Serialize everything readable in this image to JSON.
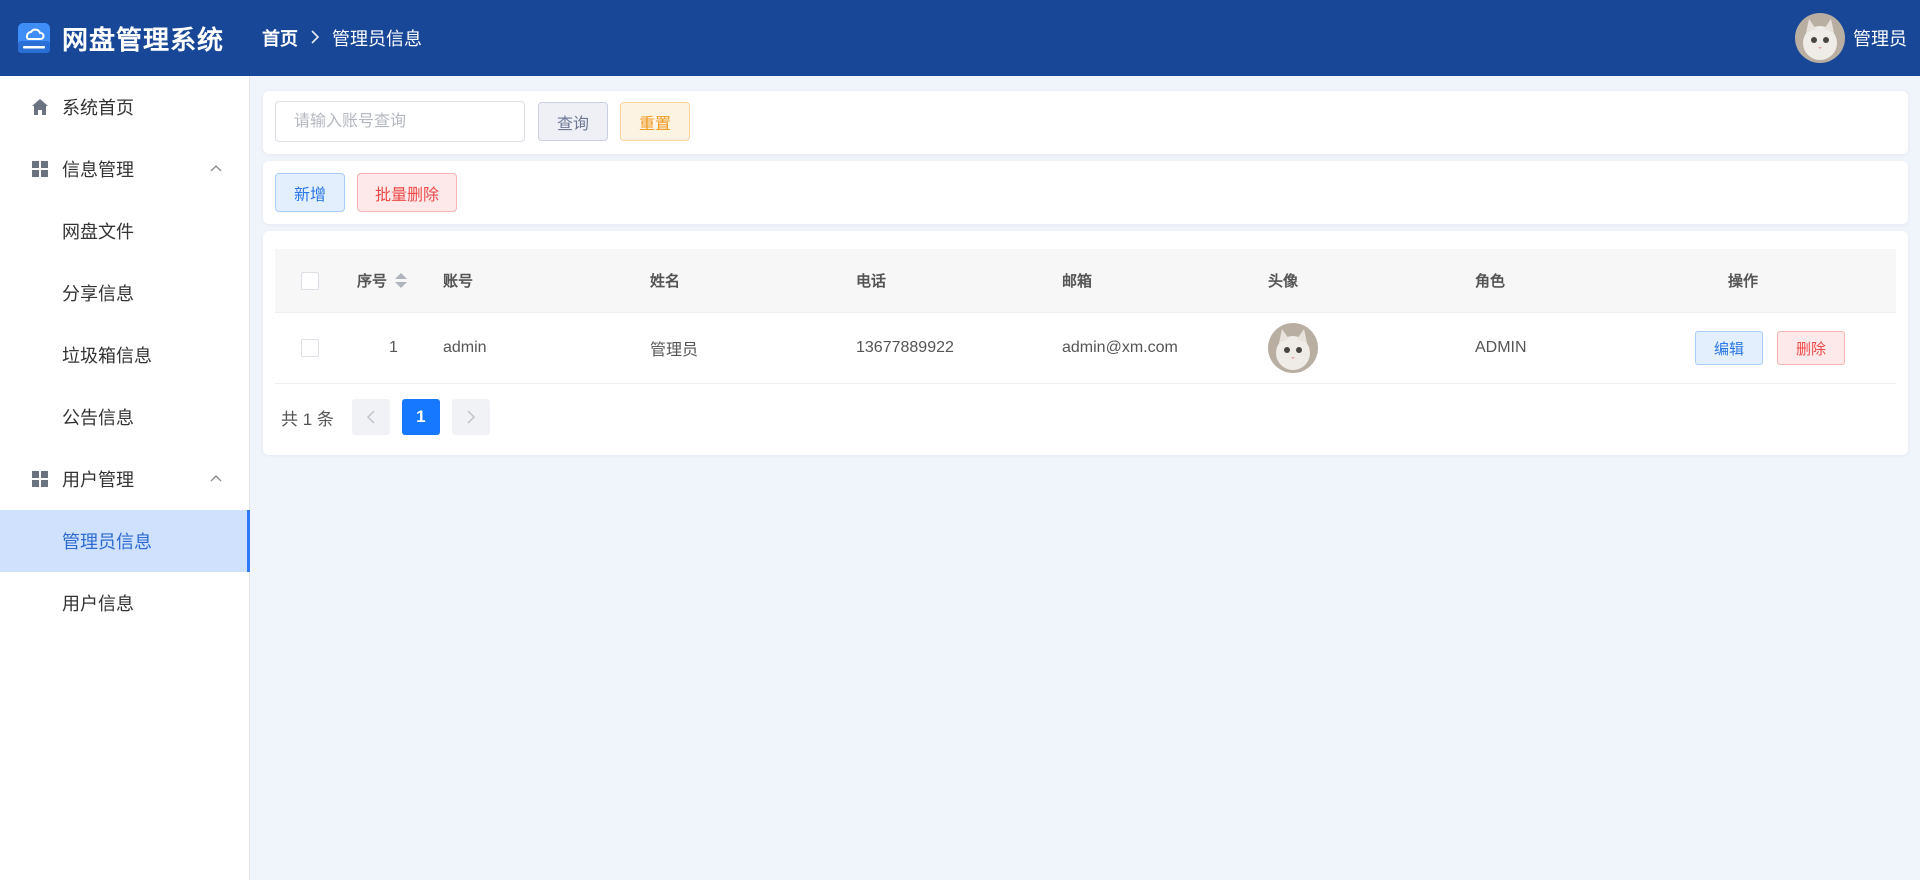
{
  "app": {
    "title": "网盘管理系统"
  },
  "header": {
    "breadcrumb_home": "首页",
    "breadcrumb_current": "管理员信息",
    "user_name": "管理员"
  },
  "sidebar": {
    "home_label": "系统首页",
    "groups": [
      {
        "label": "信息管理",
        "items": [
          "网盘文件",
          "分享信息",
          "垃圾箱信息",
          "公告信息"
        ]
      },
      {
        "label": "用户管理",
        "items": [
          "管理员信息",
          "用户信息"
        ]
      }
    ],
    "active_item": "管理员信息"
  },
  "search": {
    "placeholder": "请输入账号查询",
    "query_label": "查询",
    "reset_label": "重置"
  },
  "operations": {
    "add_label": "新增",
    "batch_delete_label": "批量删除"
  },
  "table": {
    "columns": [
      "序号",
      "账号",
      "姓名",
      "电话",
      "邮箱",
      "头像",
      "角色",
      "操作"
    ],
    "rows": [
      {
        "index": "1",
        "username": "admin",
        "name": "管理员",
        "phone": "13677889922",
        "email": "admin@xm.com",
        "role": "ADMIN",
        "edit_label": "编辑",
        "delete_label": "删除"
      }
    ]
  },
  "pagination": {
    "total_text": "共 1 条",
    "current_page": "1"
  },
  "colors": {
    "header_bg": "#184797",
    "primary": "#1677ff",
    "danger": "#ee4a4a",
    "warning": "#ef9a20"
  }
}
